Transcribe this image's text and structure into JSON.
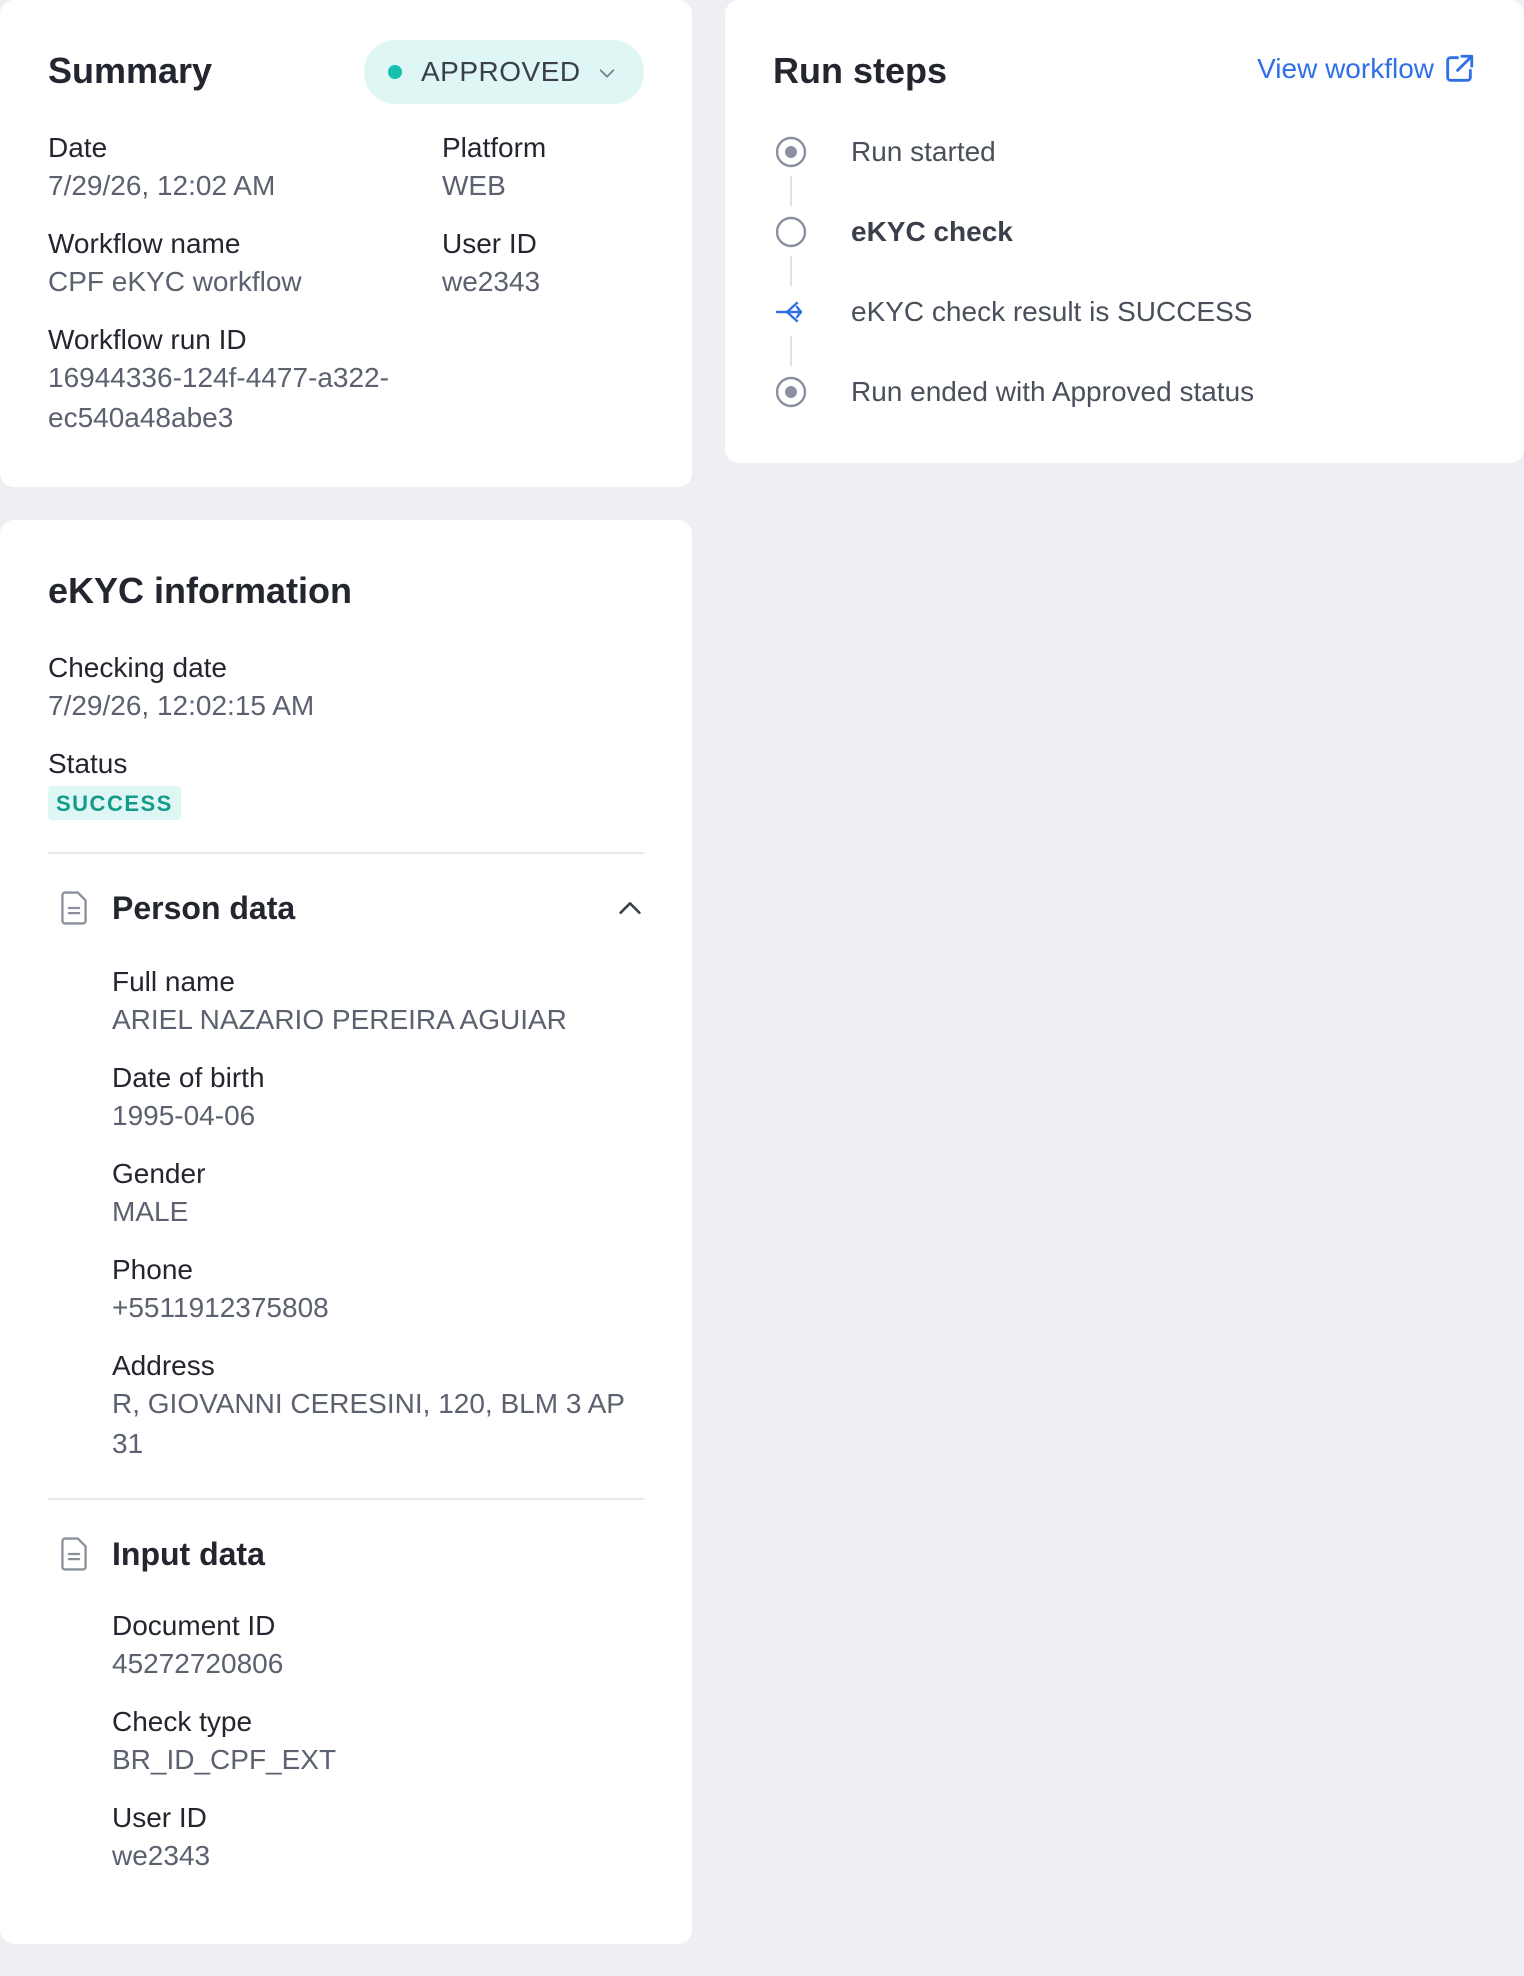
{
  "summary": {
    "title": "Summary",
    "status": "APPROVED",
    "status_color": "#15bfae",
    "fields": {
      "date_label": "Date",
      "date_value": "7/29/26, 12:02 AM",
      "platform_label": "Platform",
      "platform_value": "WEB",
      "workflow_name_label": "Workflow name",
      "workflow_name_value": "CPF eKYC workflow",
      "user_id_label": "User ID",
      "user_id_value": "we2343",
      "run_id_label": "Workflow run ID",
      "run_id_line1": "16944336-124f-4477-a322-",
      "run_id_line2": "ec540a48abe3"
    }
  },
  "ekyc": {
    "title": "eKYC information",
    "checking_date_label": "Checking date",
    "checking_date_value": "7/29/26, 12:02:15 AM",
    "status_label": "Status",
    "status_value": "SUCCESS",
    "person_data": {
      "title": "Person data",
      "full_name_label": "Full name",
      "full_name_value": "ARIEL NAZARIO PEREIRA AGUIAR",
      "dob_label": "Date of birth",
      "dob_value": "1995-04-06",
      "gender_label": "Gender",
      "gender_value": "MALE",
      "phone_label": "Phone",
      "phone_value": "+5511912375808",
      "address_label": "Address",
      "address_line1": "R, GIOVANNI CERESINI, 120, BLM 3 AP",
      "address_line2": "31"
    },
    "input_data": {
      "title": "Input data",
      "document_id_label": "Document ID",
      "document_id_value": "45272720806",
      "check_type_label": "Check type",
      "check_type_value": "BR_ID_CPF_EXT",
      "user_id_label": "User ID",
      "user_id_value": "we2343"
    }
  },
  "run_steps": {
    "title": "Run steps",
    "view_workflow": "View workflow",
    "link_color": "#2f6fe8",
    "steps": [
      {
        "label": "Run started",
        "icon": "radio-dot-icon"
      },
      {
        "label": "eKYC check",
        "icon": "circle-outline-icon"
      },
      {
        "label": "eKYC check result is SUCCESS",
        "icon": "branch-icon"
      },
      {
        "label": "Run ended with Approved status",
        "icon": "radio-dot-icon"
      }
    ]
  }
}
